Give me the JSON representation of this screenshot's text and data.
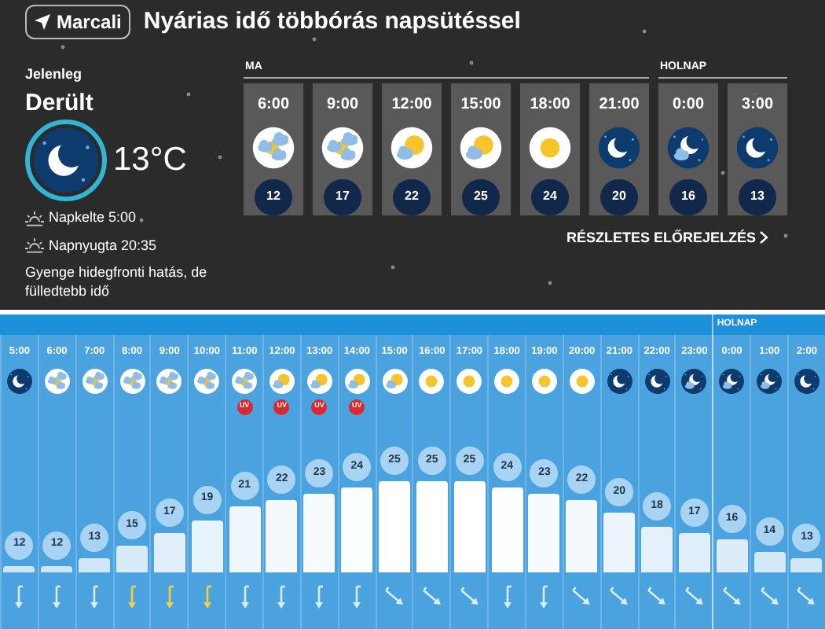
{
  "location_button": "Marcali",
  "headline": "Nyárias idő többórás napsütéssel",
  "current": {
    "label": "Jelenleg",
    "condition": "Derült",
    "kind": "night",
    "temperature": "13°C",
    "sunrise": "Napkelte 5:00",
    "sunset": "Napnyugta 20:35",
    "description": "Gyenge hidegfronti hatás, de fülledtebb idő"
  },
  "forecast_days": [
    {
      "label": "MA",
      "slots": [
        {
          "time": "6:00",
          "kind": "cloud-sun",
          "temp": "12"
        },
        {
          "time": "9:00",
          "kind": "cloud-sun",
          "temp": "17"
        },
        {
          "time": "12:00",
          "kind": "sun-cloud",
          "temp": "22"
        },
        {
          "time": "15:00",
          "kind": "sun-cloud",
          "temp": "25"
        },
        {
          "time": "18:00",
          "kind": "sun",
          "temp": "24"
        },
        {
          "time": "21:00",
          "kind": "night",
          "temp": "20"
        }
      ]
    },
    {
      "label": "HOLNAP",
      "slots": [
        {
          "time": "0:00",
          "kind": "night-cloud",
          "temp": "16"
        },
        {
          "time": "3:00",
          "kind": "night",
          "temp": "13"
        }
      ]
    }
  ],
  "details_link": "RÉSZLETES ELŐREJELZÉS",
  "hourly": [
    {
      "time": "5:00",
      "kind": "night",
      "temp": "12",
      "wind": {
        "kind": "down",
        "gust": false
      }
    },
    {
      "time": "6:00",
      "kind": "cloud-sun",
      "temp": "12",
      "wind": {
        "kind": "down",
        "gust": false
      }
    },
    {
      "time": "7:00",
      "kind": "cloud-sun",
      "temp": "13",
      "wind": {
        "kind": "down",
        "gust": false
      }
    },
    {
      "time": "8:00",
      "kind": "cloud-sun",
      "temp": "15",
      "wind": {
        "kind": "down",
        "gust": true
      }
    },
    {
      "time": "9:00",
      "kind": "cloud-sun",
      "temp": "17",
      "wind": {
        "kind": "down",
        "gust": true
      }
    },
    {
      "time": "10:00",
      "kind": "cloud-sun",
      "temp": "19",
      "wind": {
        "kind": "down",
        "gust": true
      }
    },
    {
      "time": "11:00",
      "kind": "cloud-sun",
      "uv_badge": "UV",
      "temp": "21",
      "wind": {
        "kind": "down",
        "gust": false
      }
    },
    {
      "time": "12:00",
      "kind": "sun-cloud",
      "uv_badge": "UV",
      "temp": "22",
      "wind": {
        "kind": "down",
        "gust": false
      }
    },
    {
      "time": "13:00",
      "kind": "sun-cloud",
      "uv_badge": "UV",
      "temp": "23",
      "wind": {
        "kind": "down",
        "gust": false
      }
    },
    {
      "time": "14:00",
      "kind": "sun-cloud",
      "uv_badge": "UV",
      "temp": "24",
      "wind": {
        "kind": "down",
        "gust": false
      }
    },
    {
      "time": "15:00",
      "kind": "sun-cloud",
      "temp": "25",
      "wind": {
        "kind": "down-right",
        "gust": false
      }
    },
    {
      "time": "16:00",
      "kind": "sun",
      "temp": "25",
      "wind": {
        "kind": "down-right",
        "gust": false
      }
    },
    {
      "time": "17:00",
      "kind": "sun",
      "temp": "25",
      "wind": {
        "kind": "down-right",
        "gust": false
      }
    },
    {
      "time": "18:00",
      "kind": "sun",
      "temp": "24",
      "wind": {
        "kind": "down",
        "gust": false
      }
    },
    {
      "time": "19:00",
      "kind": "sun",
      "temp": "23",
      "wind": {
        "kind": "down",
        "gust": false
      }
    },
    {
      "time": "20:00",
      "kind": "sun",
      "temp": "22",
      "wind": {
        "kind": "down-right",
        "gust": false
      }
    },
    {
      "time": "21:00",
      "kind": "night",
      "temp": "20",
      "wind": {
        "kind": "down-right",
        "gust": false
      }
    },
    {
      "time": "22:00",
      "kind": "night",
      "temp": "18",
      "wind": {
        "kind": "down-right",
        "gust": false
      }
    },
    {
      "time": "23:00",
      "kind": "night-cloud",
      "temp": "17",
      "wind": {
        "kind": "down-right",
        "gust": false
      }
    },
    {
      "time": "0:00",
      "kind": "night-cloud",
      "temp": "16",
      "wind": {
        "kind": "down-right",
        "gust": false
      },
      "day_label": "HOLNAP"
    },
    {
      "time": "1:00",
      "kind": "night-cloud",
      "temp": "14",
      "wind": {
        "kind": "down-right",
        "gust": false
      }
    },
    {
      "time": "2:00",
      "kind": "night",
      "temp": "13",
      "wind": {
        "kind": "down-right",
        "gust": false
      }
    }
  ]
}
